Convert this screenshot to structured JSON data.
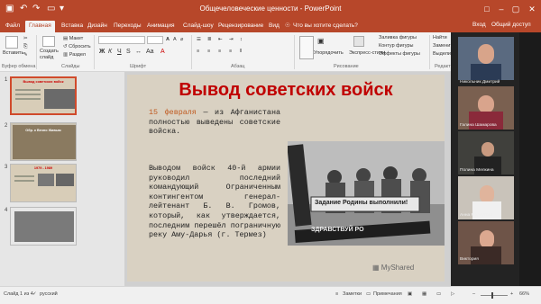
{
  "window": {
    "title": "Общечеловеческие ценности - PowerPoint",
    "account": "Никольник Дмитрий"
  },
  "tabs": [
    {
      "label": "Файл"
    },
    {
      "label": "Главная"
    },
    {
      "label": "Вставка"
    },
    {
      "label": "Дизайн"
    },
    {
      "label": "Переходы"
    },
    {
      "label": "Анимация"
    },
    {
      "label": "Слайд-шоу"
    },
    {
      "label": "Рецензирование"
    },
    {
      "label": "Вид"
    },
    {
      "label": "Что вы хотите сделать?"
    }
  ],
  "tabs_right": {
    "signin": "Вход",
    "share": "Общий доступ"
  },
  "ribbon": {
    "paste": "Вставить",
    "create_slide": "Создать слайд",
    "layout": "Макет",
    "reset": "Сбросить",
    "section": "Раздел",
    "shape_fill": "Заливка фигуры",
    "shape_outline": "Контур фигуры",
    "shape_effects": "Эффекты фигуры",
    "arrange": "Упорядочить",
    "express_styles": "Экспресс-стили",
    "find": "Найти",
    "replace": "Заменить",
    "select": "Выделить",
    "groups": {
      "clipboard": "Буфер обмена",
      "slides": "Слайды",
      "font": "Шрифт",
      "paragraph": "Абзац",
      "drawing": "Рисование",
      "editing": "Редактирование"
    }
  },
  "thumbnails": [
    {
      "number": "1",
      "title": "Вывод советских войск"
    },
    {
      "number": "2",
      "title": "Обр. к Вечно Живым"
    },
    {
      "number": "3",
      "title": "1979 - 1989"
    },
    {
      "number": "4",
      "title": ""
    }
  ],
  "slide": {
    "title": "Вывод советских войск",
    "para1_date": "15 февраля",
    "para1_rest": " — из Афганистана полностью выведены советские войска.",
    "para2": "Выводом войск 40-й армии руководил последний командующий Ограниченным контингентом генерал-лейтенант Б. В. Громов, который, как утверждается, последним перешёл пограничную реку Аму-Дарья (г. Термез)",
    "photo_banner1": "Задание Родины выполнили!",
    "photo_banner2": "ЗДРАВСТВУЙ РО",
    "watermark": "MyShared"
  },
  "participants": [
    {
      "name": "Никольник Дмитрий"
    },
    {
      "name": "Галина Шамарова"
    },
    {
      "name": "Полина Мелкина"
    },
    {
      "name": "Анна Морхутова"
    },
    {
      "name": "Виктория"
    }
  ],
  "statusbar": {
    "slide_info": "Слайд 1 из 4",
    "language": "русский",
    "notes": "Заметки",
    "comments": "Примечания",
    "zoom": "66%"
  },
  "colors": {
    "accent": "#b7472a",
    "slide_title": "#c00000",
    "slide_bg": "#d9d1c2"
  }
}
